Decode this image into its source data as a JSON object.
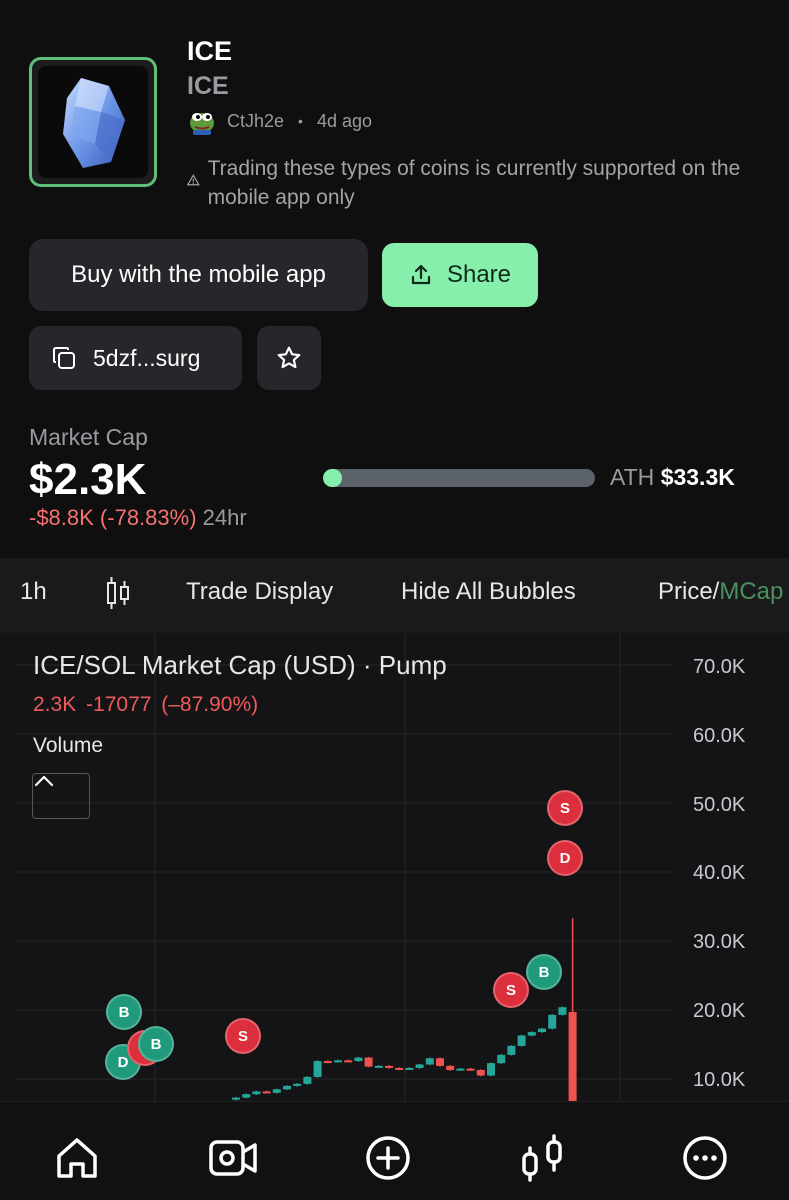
{
  "token": {
    "name": "ICE",
    "symbol": "ICE",
    "creator": "CtJh2e",
    "age": "4d ago",
    "separator": "•",
    "warning": "Trading these types of coins is currently supported on the mobile app only"
  },
  "actions": {
    "buy_label": "Buy with the mobile app",
    "share_label": "Share",
    "contract_short": "5dzf...surg"
  },
  "market": {
    "label": "Market Cap",
    "value": "$2.3K",
    "change": "-$8.8K (-78.83%)",
    "period": "24hr",
    "ath_label": "ATH",
    "ath_value": "$33.3K",
    "progress_fraction": 0.07
  },
  "toolbar": {
    "interval": "1h",
    "trade_display": "Trade Display",
    "hide_bubbles": "Hide All Bubbles",
    "price_label": "Price/",
    "mcap_label": "MCap"
  },
  "chart": {
    "title": "ICE/SOL Market Cap (USD) · Pump",
    "sub": "2.3K -17077 (–87.90%)",
    "volume_label": "Volume",
    "y_ticks": [
      "70.0K",
      "60.0K",
      "50.0K",
      "40.0K",
      "30.0K",
      "20.0K",
      "10.0K"
    ],
    "bubbles": [
      {
        "label": "B",
        "kind": "buy"
      },
      {
        "label": "D",
        "kind": "dev-g"
      },
      {
        "label": "B",
        "kind": "buy"
      },
      {
        "label": "S",
        "kind": "sell"
      },
      {
        "label": "S",
        "kind": "sell"
      },
      {
        "label": "D",
        "kind": "dev"
      },
      {
        "label": "S",
        "kind": "sell"
      },
      {
        "label": "B",
        "kind": "buy"
      }
    ]
  },
  "chart_data": {
    "type": "candlestick",
    "title": "ICE/SOL Market Cap (USD) · Pump",
    "ylabel": "",
    "ylim": [
      6000,
      72000
    ],
    "y_ticks": [
      10000,
      20000,
      30000,
      40000,
      50000,
      60000,
      70000
    ],
    "candles": [
      {
        "o": 7000,
        "c": 7300,
        "h": 7400,
        "l": 6900
      },
      {
        "o": 7300,
        "c": 7800,
        "h": 7900,
        "l": 7200
      },
      {
        "o": 7800,
        "c": 8200,
        "h": 8300,
        "l": 7700
      },
      {
        "o": 8200,
        "c": 8000,
        "h": 8300,
        "l": 7900
      },
      {
        "o": 8000,
        "c": 8500,
        "h": 8600,
        "l": 7900
      },
      {
        "o": 8500,
        "c": 9000,
        "h": 9100,
        "l": 8400
      },
      {
        "o": 9000,
        "c": 9300,
        "h": 9400,
        "l": 8900
      },
      {
        "o": 9300,
        "c": 10300,
        "h": 10400,
        "l": 9200
      },
      {
        "o": 10300,
        "c": 12600,
        "h": 12700,
        "l": 10200
      },
      {
        "o": 12600,
        "c": 12500,
        "h": 12700,
        "l": 12300
      },
      {
        "o": 12500,
        "c": 12700,
        "h": 12800,
        "l": 12400
      },
      {
        "o": 12700,
        "c": 12600,
        "h": 12800,
        "l": 12500
      },
      {
        "o": 12600,
        "c": 13100,
        "h": 13200,
        "l": 12500
      },
      {
        "o": 13100,
        "c": 11800,
        "h": 13200,
        "l": 11700
      },
      {
        "o": 11800,
        "c": 11900,
        "h": 12000,
        "l": 11700
      },
      {
        "o": 11900,
        "c": 11600,
        "h": 12000,
        "l": 11500
      },
      {
        "o": 11600,
        "c": 11400,
        "h": 11700,
        "l": 11300
      },
      {
        "o": 11400,
        "c": 11600,
        "h": 11700,
        "l": 11300
      },
      {
        "o": 11600,
        "c": 12100,
        "h": 12200,
        "l": 11500
      },
      {
        "o": 12100,
        "c": 13000,
        "h": 13100,
        "l": 12000
      },
      {
        "o": 13000,
        "c": 11900,
        "h": 13100,
        "l": 11800
      },
      {
        "o": 11900,
        "c": 11300,
        "h": 12000,
        "l": 11200
      },
      {
        "o": 11300,
        "c": 11500,
        "h": 11600,
        "l": 11200
      },
      {
        "o": 11500,
        "c": 11300,
        "h": 11600,
        "l": 11200
      },
      {
        "o": 11300,
        "c": 10500,
        "h": 11400,
        "l": 10400
      },
      {
        "o": 10500,
        "c": 12300,
        "h": 12400,
        "l": 10400
      },
      {
        "o": 12300,
        "c": 13500,
        "h": 13600,
        "l": 12200
      },
      {
        "o": 13500,
        "c": 14800,
        "h": 14900,
        "l": 13400
      },
      {
        "o": 14800,
        "c": 16300,
        "h": 16400,
        "l": 14700
      },
      {
        "o": 16300,
        "c": 16800,
        "h": 16900,
        "l": 16200
      },
      {
        "o": 16800,
        "c": 17300,
        "h": 17400,
        "l": 16700
      },
      {
        "o": 17300,
        "c": 19300,
        "h": 19400,
        "l": 17200
      },
      {
        "o": 19300,
        "c": 20400,
        "h": 20500,
        "l": 19200
      },
      {
        "o": 19700,
        "c": 6000,
        "h": 33300,
        "l": 6000
      }
    ]
  },
  "colors": {
    "accent_green": "#86efac",
    "up": "#26a69a",
    "down": "#ef5350",
    "negative_text": "#f87171"
  },
  "nav": {
    "items": [
      "home-icon",
      "video-icon",
      "plus-circle-icon",
      "chart-candles-icon",
      "more-icon"
    ]
  }
}
